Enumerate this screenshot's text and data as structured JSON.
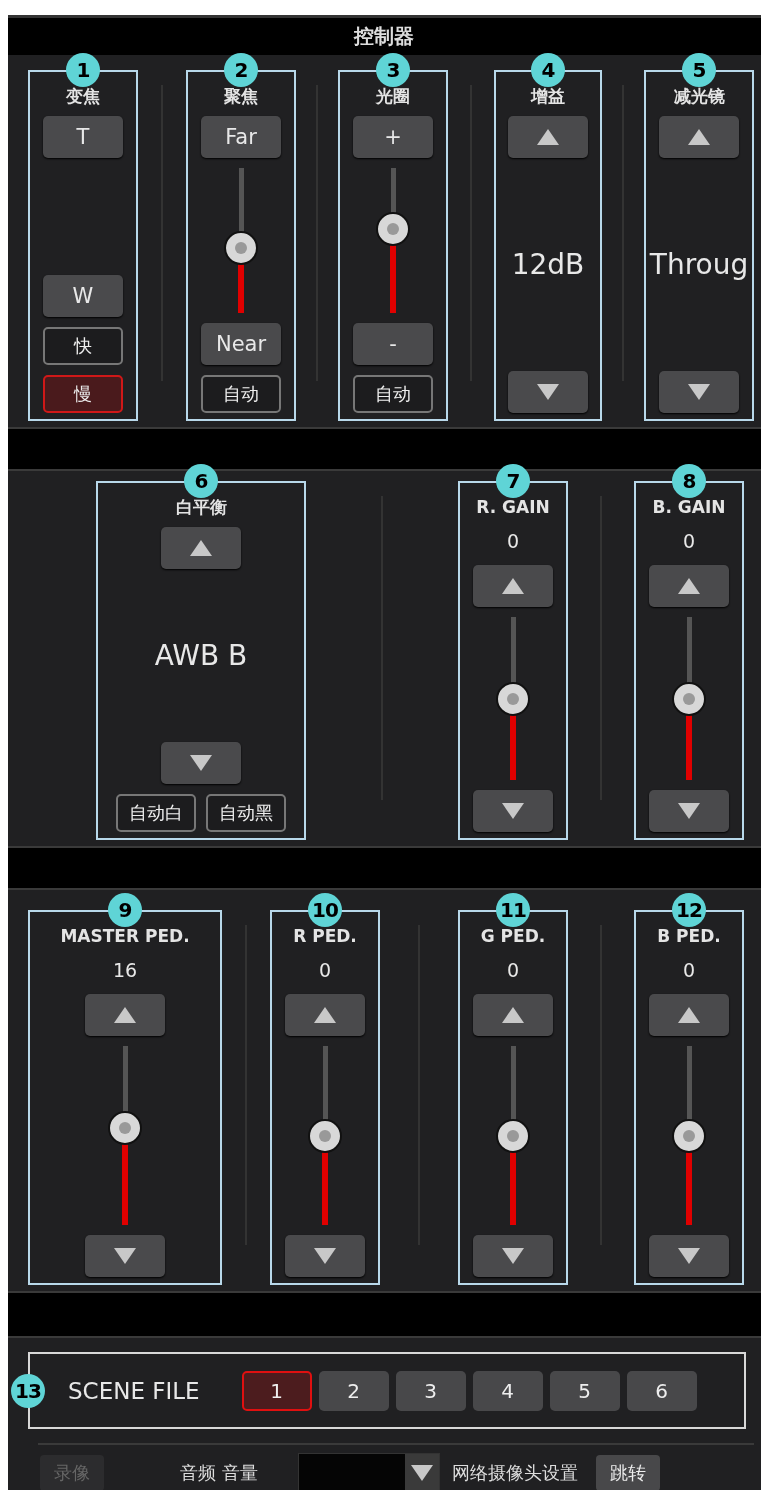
{
  "title": "控制器",
  "sections": [
    {
      "groups": [
        {
          "badge": "1",
          "label": "变焦",
          "items": [
            {
              "kind": "button",
              "text": "T"
            },
            {
              "kind": "button",
              "text": "W"
            },
            {
              "kind": "toggle",
              "text": "快",
              "selected": false
            },
            {
              "kind": "toggle",
              "text": "慢",
              "selected": true
            }
          ]
        },
        {
          "badge": "2",
          "label": "聚焦",
          "items": [
            {
              "kind": "button",
              "text": "Far"
            },
            {
              "kind": "slider",
              "level": 0.45
            },
            {
              "kind": "button",
              "text": "Near"
            },
            {
              "kind": "toggle",
              "text": "自动",
              "selected": false
            }
          ]
        },
        {
          "badge": "3",
          "label": "光圈",
          "items": [
            {
              "kind": "button",
              "text": "+"
            },
            {
              "kind": "slider",
              "level": 0.58
            },
            {
              "kind": "button",
              "text": "-"
            },
            {
              "kind": "toggle",
              "text": "自动",
              "selected": false
            }
          ]
        },
        {
          "badge": "4",
          "label": "增益",
          "items": [
            {
              "kind": "up"
            },
            {
              "kind": "value",
              "text": "12dB"
            },
            {
              "kind": "down"
            }
          ]
        },
        {
          "badge": "5",
          "label": "减光镜",
          "items": [
            {
              "kind": "up"
            },
            {
              "kind": "value",
              "text": "Throug"
            },
            {
              "kind": "down"
            }
          ]
        }
      ]
    },
    {
      "groups": [
        {
          "badge": "6",
          "label": "白平衡",
          "items": [
            {
              "kind": "up"
            },
            {
              "kind": "value",
              "text": "AWB B"
            },
            {
              "kind": "down"
            },
            {
              "kind": "row",
              "items": [
                {
                  "kind": "toggle",
                  "text": "自动白",
                  "selected": false
                },
                {
                  "kind": "toggle",
                  "text": "自动黑",
                  "selected": false
                }
              ]
            }
          ]
        },
        {
          "badge": "7",
          "label": "R. GAIN",
          "items": [
            {
              "kind": "reading",
              "text": "0"
            },
            {
              "kind": "up"
            },
            {
              "kind": "slider",
              "level": 0.5
            },
            {
              "kind": "down"
            }
          ]
        },
        {
          "badge": "8",
          "label": "B. GAIN",
          "items": [
            {
              "kind": "reading",
              "text": "0"
            },
            {
              "kind": "up"
            },
            {
              "kind": "slider",
              "level": 0.5
            },
            {
              "kind": "down"
            }
          ]
        }
      ]
    },
    {
      "groups": [
        {
          "badge": "9",
          "label": "MASTER PED.",
          "items": [
            {
              "kind": "reading",
              "text": "16"
            },
            {
              "kind": "up"
            },
            {
              "kind": "slider",
              "level": 0.54
            },
            {
              "kind": "down"
            }
          ]
        },
        {
          "badge": "10",
          "label": "R PED.",
          "items": [
            {
              "kind": "reading",
              "text": "0"
            },
            {
              "kind": "up"
            },
            {
              "kind": "slider",
              "level": 0.5
            },
            {
              "kind": "down"
            }
          ]
        },
        {
          "badge": "11",
          "label": "G PED.",
          "items": [
            {
              "kind": "reading",
              "text": "0"
            },
            {
              "kind": "up"
            },
            {
              "kind": "slider",
              "level": 0.5
            },
            {
              "kind": "down"
            }
          ]
        },
        {
          "badge": "12",
          "label": "B PED.",
          "items": [
            {
              "kind": "reading",
              "text": "0"
            },
            {
              "kind": "up"
            },
            {
              "kind": "slider",
              "level": 0.5
            },
            {
              "kind": "down"
            }
          ]
        }
      ]
    }
  ],
  "scene_file": {
    "badge": "13",
    "label": "SCENE FILE",
    "buttons": [
      {
        "text": "1",
        "selected": true
      },
      {
        "text": "2",
        "selected": false
      },
      {
        "text": "3",
        "selected": false
      },
      {
        "text": "4",
        "selected": false
      },
      {
        "text": "5",
        "selected": false
      },
      {
        "text": "6",
        "selected": false
      }
    ]
  },
  "bottom_bar": {
    "record_button": {
      "text": "录像",
      "disabled": true
    },
    "audio_label": "音频 音量",
    "network_label": "网络摄像头设置",
    "jump_button": {
      "text": "跳转",
      "disabled": false
    }
  }
}
